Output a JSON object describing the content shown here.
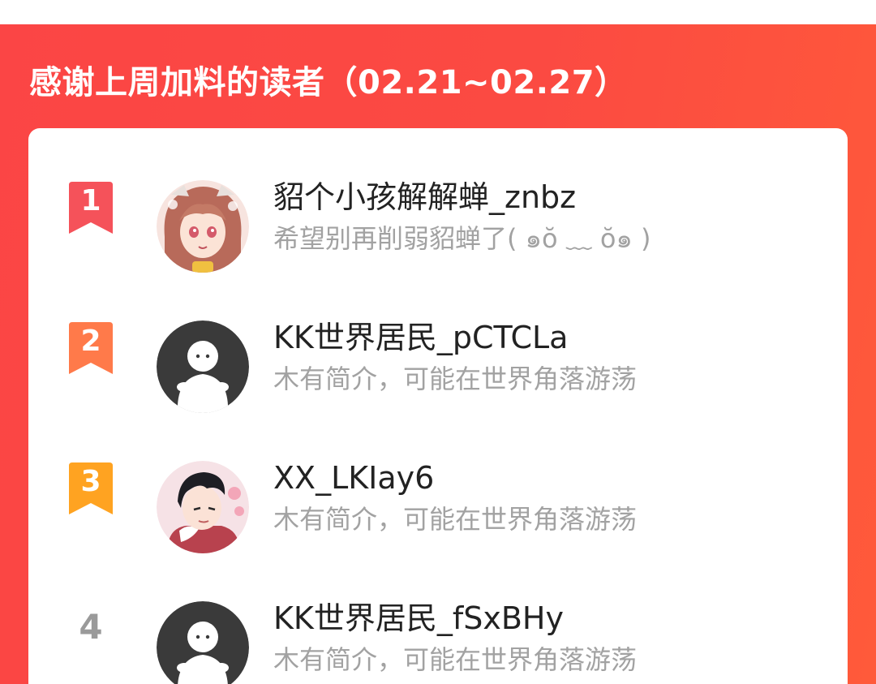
{
  "panel": {
    "title": "感谢上周加料的读者（02.21~02.27）"
  },
  "colors": {
    "panel_red": "#fb4545",
    "rank1": "#f5525a",
    "rank2": "#ff7a4a",
    "rank3": "#ffa321",
    "rank_plain": "#9a9a9a"
  },
  "readers": [
    {
      "rank": "1",
      "name": "貂个小孩解解蝉_znbz",
      "bio": "希望别再削弱貂蝉了( ๑ŏ ﹏ ŏ๑ )",
      "avatar": "anime-girl-avatar"
    },
    {
      "rank": "2",
      "name": "KK世界居民_pCTCLa",
      "bio": "木有简介，可能在世界角落游荡",
      "avatar": "default-avatar"
    },
    {
      "rank": "3",
      "name": "XX_LKIay6",
      "bio": "木有简介，可能在世界角落游荡",
      "avatar": "anime-boy-avatar"
    },
    {
      "rank": "4",
      "name": "KK世界居民_fSxBHy",
      "bio": "木有简介，可能在世界角落游荡",
      "avatar": "default-avatar"
    }
  ]
}
